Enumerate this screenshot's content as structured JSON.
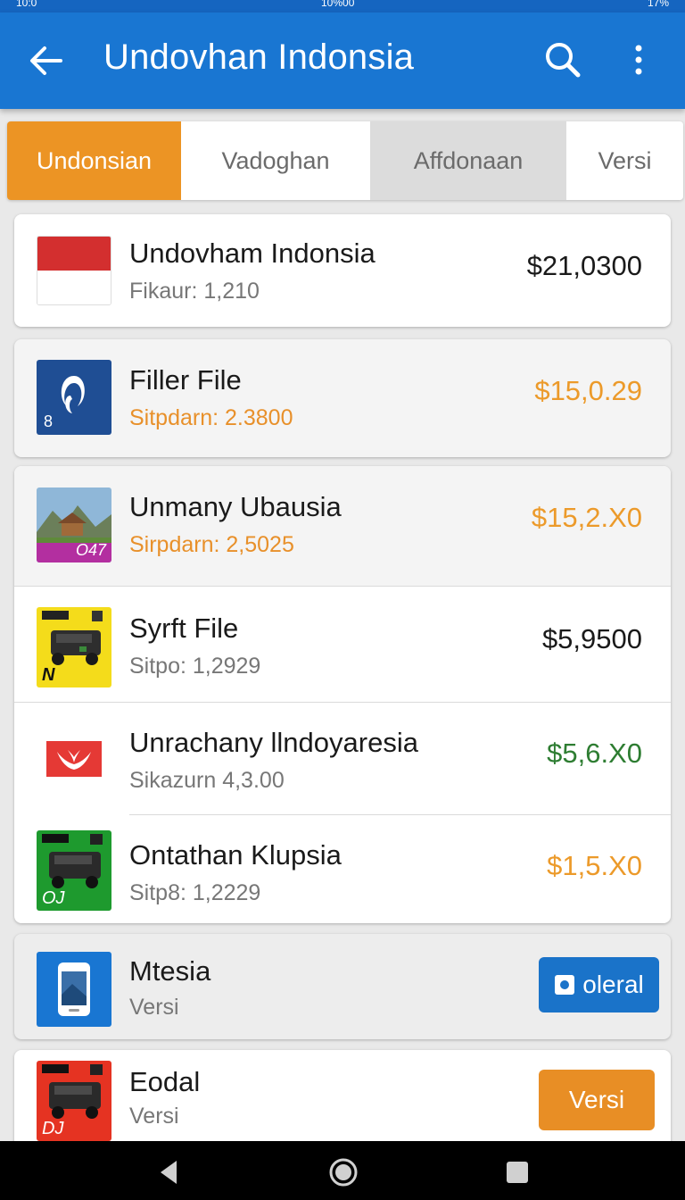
{
  "status_bar": {
    "left": "10:0",
    "center": "10%00",
    "right": "17%"
  },
  "app_bar": {
    "title": "Undovhan Indonsia",
    "back_icon": "arrow-left-icon",
    "search_icon": "search-icon",
    "more_icon": "more-vert-icon"
  },
  "tabs": [
    {
      "label": "Undonsian",
      "selected": true
    },
    {
      "label": "Vadoghan"
    },
    {
      "label": "Affdonaan"
    },
    {
      "label": "Versi"
    }
  ],
  "items": [
    {
      "name": "Undovham Indonsia",
      "sub": "Fikaur: 1,210",
      "price": "$21,0300",
      "icon": "indonesia-flag-icon"
    },
    {
      "name": "Filler File",
      "sub": "Sitpdarn: 2.3800",
      "price": "$15,0.29",
      "icon": "app-logo-icon",
      "thumb_text": "8"
    },
    {
      "name": "Unmany Ubausia",
      "sub": "Sirpdarn: 2,5025",
      "price": "$15,2.X0",
      "icon": "landscape-photo-icon",
      "thumb_text": "O47"
    },
    {
      "name": "Syrft File",
      "sub": "Sitpo: 1,2929",
      "price": "$5,9500",
      "icon": "projector-yellow-icon",
      "thumb_text": "N"
    },
    {
      "name": "Unrachany llndoyaresia",
      "sub": "Sikazurn 4,3.00",
      "price": "$5,6.X0",
      "icon": "bird-logo-icon"
    },
    {
      "name": "Ontathan Klupsia",
      "sub": "Sitp8: 1,2229",
      "price": "$1,5.X0",
      "icon": "projector-green-icon",
      "thumb_text": "OJ"
    }
  ],
  "card_mtesia": {
    "name": "Mtesia",
    "sub": "Versi",
    "button_label": "oleral",
    "icon": "phone-icon"
  },
  "card_eodal": {
    "name": "Eodal",
    "sub": "Versi",
    "button_label": "Versi",
    "icon": "projector-red-icon",
    "thumb_text": "DJ"
  },
  "nav_bar": {
    "back": "back-triangle-icon",
    "home": "home-circle-icon",
    "recents": "recents-square-icon"
  },
  "colors": {
    "primary": "#1976d2",
    "accent": "#ec9424",
    "green": "#2e7d32"
  }
}
